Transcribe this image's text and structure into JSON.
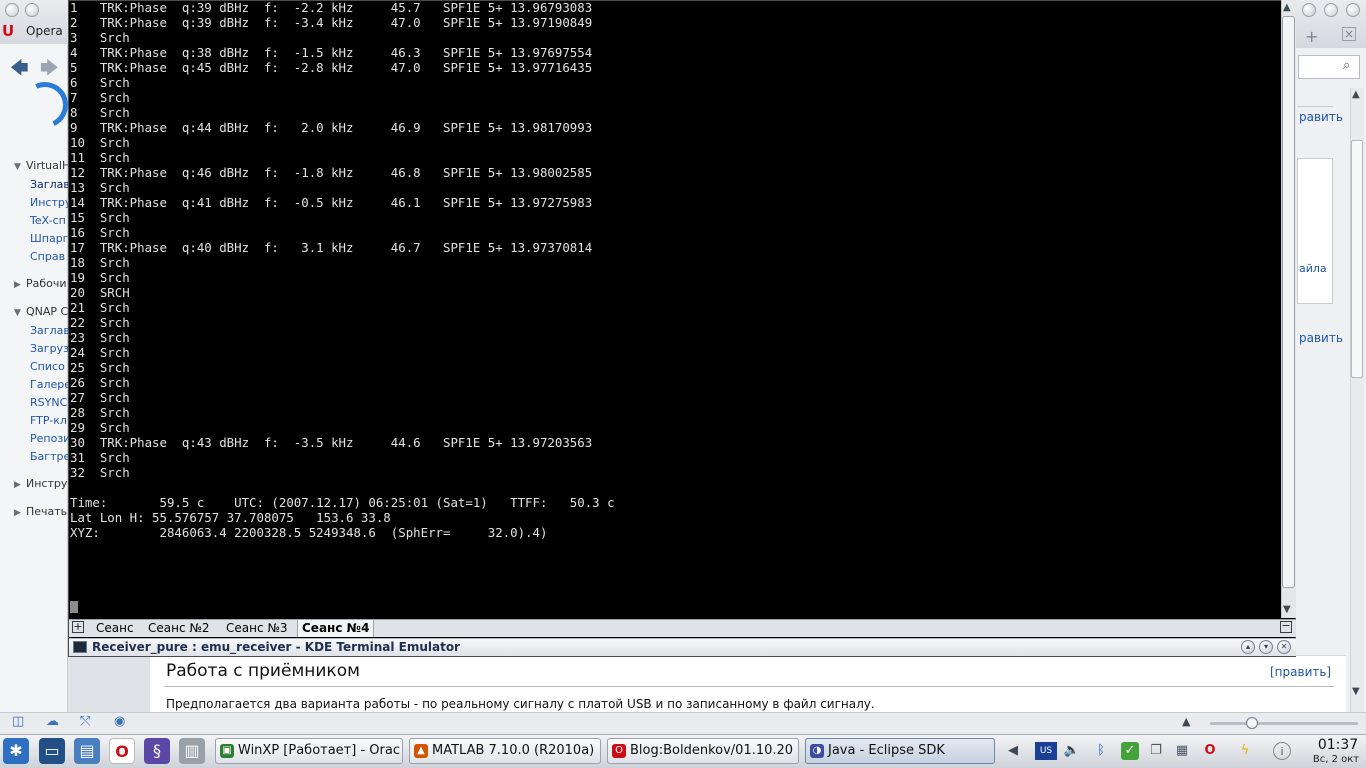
{
  "browser": {
    "app_label": "Opera",
    "sidebar": {
      "section1": "VirtualH",
      "section1_items": [
        "Заглав",
        "Инстру",
        "TeX-сп",
        "Шпарг",
        "Справ"
      ],
      "section2": "Рабочи",
      "section3": "QNAP C",
      "section3_items": [
        "Заглав",
        "Загруз",
        "Списо",
        "Галере",
        "RSYNC",
        "FTP-кл",
        "Репози",
        "Багтре"
      ],
      "section4": "Инстру",
      "section5": "Печать"
    },
    "right_edit_link": "равить",
    "right_panel_link": "айла",
    "article": {
      "title": "Работа с приёмником",
      "edit": "[править]",
      "text": "Предполагается два варианта работы - по реальному сигналу с платой USB и по записанному в файл сигналу."
    }
  },
  "terminal": {
    "window_title": "Receiver_pure : emu_receiver - KDE Terminal Emulator",
    "channels": [
      {
        "n": "1",
        "status": "TRK:Phase",
        "q": "q:39 dBHz",
        "f": "-2.2 kHz",
        "v": "45.7",
        "tag": "SPF1E 5+",
        "t": "13.96793083"
      },
      {
        "n": "2",
        "status": "TRK:Phase",
        "q": "q:39 dBHz",
        "f": "-3.4 kHz",
        "v": "47.0",
        "tag": "SPF1E 5+",
        "t": "13.97190849"
      },
      {
        "n": "3",
        "status": "Srch"
      },
      {
        "n": "4",
        "status": "TRK:Phase",
        "q": "q:38 dBHz",
        "f": "-1.5 kHz",
        "v": "46.3",
        "tag": "SPF1E 5+",
        "t": "13.97697554"
      },
      {
        "n": "5",
        "status": "TRK:Phase",
        "q": "q:45 dBHz",
        "f": "-2.8 kHz",
        "v": "47.0",
        "tag": "SPF1E 5+",
        "t": "13.97716435"
      },
      {
        "n": "6",
        "status": "Srch"
      },
      {
        "n": "7",
        "status": "Srch"
      },
      {
        "n": "8",
        "status": "Srch"
      },
      {
        "n": "9",
        "status": "TRK:Phase",
        "q": "q:44 dBHz",
        "f": "2.0 kHz",
        "v": "46.9",
        "tag": "SPF1E 5+",
        "t": "13.98170993"
      },
      {
        "n": "10",
        "status": "Srch"
      },
      {
        "n": "11",
        "status": "Srch"
      },
      {
        "n": "12",
        "status": "TRK:Phase",
        "q": "q:46 dBHz",
        "f": "-1.8 kHz",
        "v": "46.8",
        "tag": "SPF1E 5+",
        "t": "13.98002585"
      },
      {
        "n": "13",
        "status": "Srch"
      },
      {
        "n": "14",
        "status": "TRK:Phase",
        "q": "q:41 dBHz",
        "f": "-0.5 kHz",
        "v": "46.1",
        "tag": "SPF1E 5+",
        "t": "13.97275983"
      },
      {
        "n": "15",
        "status": "Srch"
      },
      {
        "n": "16",
        "status": "Srch"
      },
      {
        "n": "17",
        "status": "TRK:Phase",
        "q": "q:40 dBHz",
        "f": "3.1 kHz",
        "v": "46.7",
        "tag": "SPF1E 5+",
        "t": "13.97370814"
      },
      {
        "n": "18",
        "status": "Srch"
      },
      {
        "n": "19",
        "status": "Srch"
      },
      {
        "n": "20",
        "status": "SRCH"
      },
      {
        "n": "21",
        "status": "Srch"
      },
      {
        "n": "22",
        "status": "Srch"
      },
      {
        "n": "23",
        "status": "Srch"
      },
      {
        "n": "24",
        "status": "Srch"
      },
      {
        "n": "25",
        "status": "Srch"
      },
      {
        "n": "26",
        "status": "Srch"
      },
      {
        "n": "27",
        "status": "Srch"
      },
      {
        "n": "28",
        "status": "Srch"
      },
      {
        "n": "29",
        "status": "Srch"
      },
      {
        "n": "30",
        "status": "TRK:Phase",
        "q": "q:43 dBHz",
        "f": "-3.5 kHz",
        "v": "44.6",
        "tag": "SPF1E 5+",
        "t": "13.97203563"
      },
      {
        "n": "31",
        "status": "Srch"
      },
      {
        "n": "32",
        "status": "Srch"
      }
    ],
    "summary": {
      "time_label": "Time:",
      "time_value": "59.5 c",
      "utc": "UTC: (2007.12.17) 06:25:01 (Sat=1)",
      "ttff_label": "TTFF:",
      "ttff_value": "50.3 c",
      "latlon_label": "Lat Lon H:",
      "latlon_value": "55.576757 37.708075   153.6 33.8",
      "xyz_label": "XYZ:",
      "xyz_value": "2846063.4 2200328.5 5249348.6  (SphErr=     32.0).4)"
    },
    "tabs": [
      "Сеанс",
      "Сеанс №2",
      "Сеанс №3",
      "Сеанс №4"
    ],
    "active_tab_index": 3
  },
  "taskbar": {
    "tasks": [
      "WinXP [Работает] - Orac",
      "MATLAB  7.10.0 (R2010a)",
      "Blog:Boldenkov/01.10.20",
      "Java - Eclipse SDK"
    ],
    "clock_time": "01:37",
    "clock_date": "Вс, 2 окт"
  },
  "colors": {
    "terminal_bg": "#000000",
    "terminal_fg": "#e2e2e2",
    "link": "#1f56a8",
    "opera_red": "#cc0f16"
  }
}
